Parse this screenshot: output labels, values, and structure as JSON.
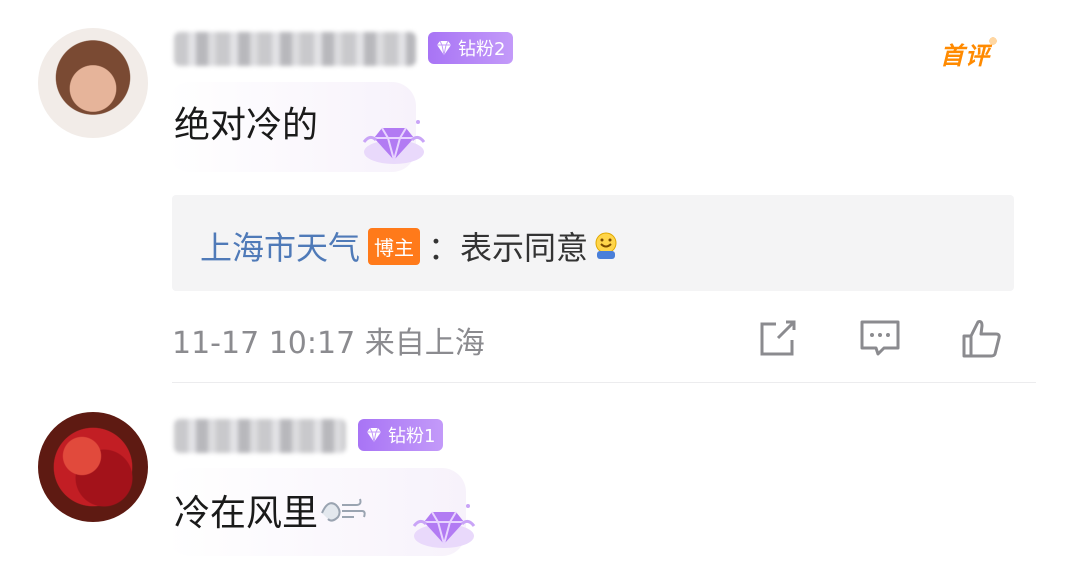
{
  "comments": [
    {
      "fan_badge": "钻粉2",
      "tag": "首评",
      "text": "绝对冷的",
      "reply": {
        "user": "上海市天气",
        "role_badge": "博主",
        "separator": "：",
        "text": "表示同意",
        "emoji_icon": "smile-emoji"
      },
      "meta": "11-17 10:17  来自上海",
      "actions": [
        "share-icon",
        "comment-icon",
        "like-icon"
      ]
    },
    {
      "fan_badge": "钻粉1",
      "text": "冷在风里",
      "emoji_icon": "wind-emoji"
    }
  ],
  "colors": {
    "fan_badge": "#a874f5",
    "first_tag": "#ff8a00",
    "reply_user": "#4f7ab8",
    "host_badge": "#ff7a1a"
  }
}
